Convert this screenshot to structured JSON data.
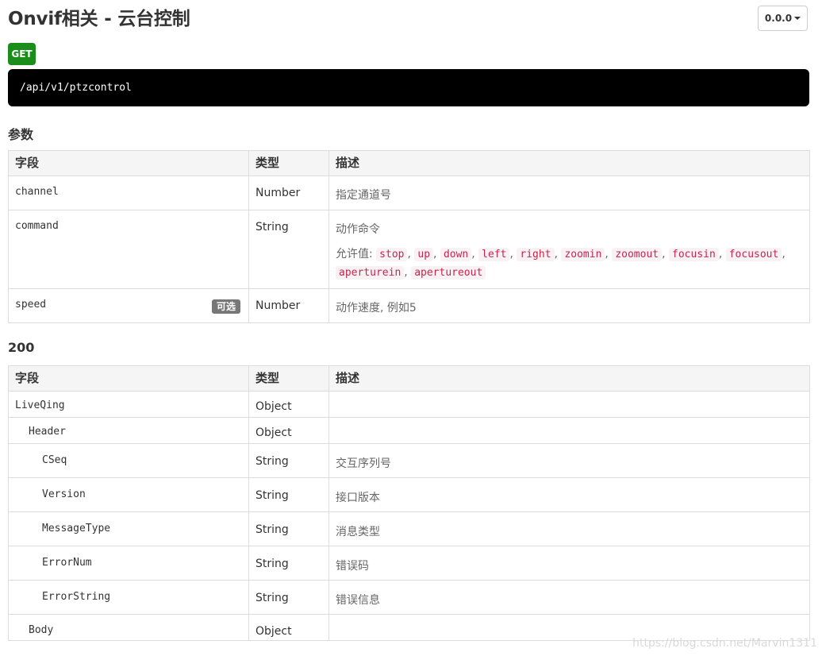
{
  "page": {
    "title": "Onvif相关 - 云台控制",
    "version_label": "0.0.0"
  },
  "endpoint": {
    "method": "GET",
    "path": "/api/v1/ptzcontrol"
  },
  "params": {
    "section_title": "参数",
    "headers": [
      "字段",
      "类型",
      "描述"
    ],
    "rows": [
      {
        "field": "channel",
        "type": "Number",
        "desc": "指定通道号"
      },
      {
        "field": "command",
        "type": "String",
        "desc": "动作命令",
        "allowed_label": "允许值:",
        "allowed_values": [
          "stop",
          "up",
          "down",
          "left",
          "right",
          "zoomin",
          "zoomout",
          "focusin",
          "focusout",
          "aperturein",
          "apertureout"
        ]
      },
      {
        "field": "speed",
        "badge": "可选",
        "type": "Number",
        "desc": "动作速度, 例如5"
      }
    ]
  },
  "response": {
    "section_title": "200",
    "headers": [
      "字段",
      "类型",
      "描述"
    ],
    "rows": [
      {
        "field": "LiveQing",
        "type": "Object",
        "desc": "",
        "indent": 0
      },
      {
        "field": "Header",
        "type": "Object",
        "desc": "",
        "indent": 1
      },
      {
        "field": "CSeq",
        "type": "String",
        "desc": "交互序列号",
        "indent": 2
      },
      {
        "field": "Version",
        "type": "String",
        "desc": "接口版本",
        "indent": 2
      },
      {
        "field": "MessageType",
        "type": "String",
        "desc": "消息类型",
        "indent": 2
      },
      {
        "field": "ErrorNum",
        "type": "String",
        "desc": "错误码",
        "indent": 2
      },
      {
        "field": "ErrorString",
        "type": "String",
        "desc": "错误信息",
        "indent": 2
      },
      {
        "field": "Body",
        "type": "Object",
        "desc": "",
        "indent": 1
      }
    ]
  },
  "watermark": "https://blog.csdn.net/Marvin1311"
}
